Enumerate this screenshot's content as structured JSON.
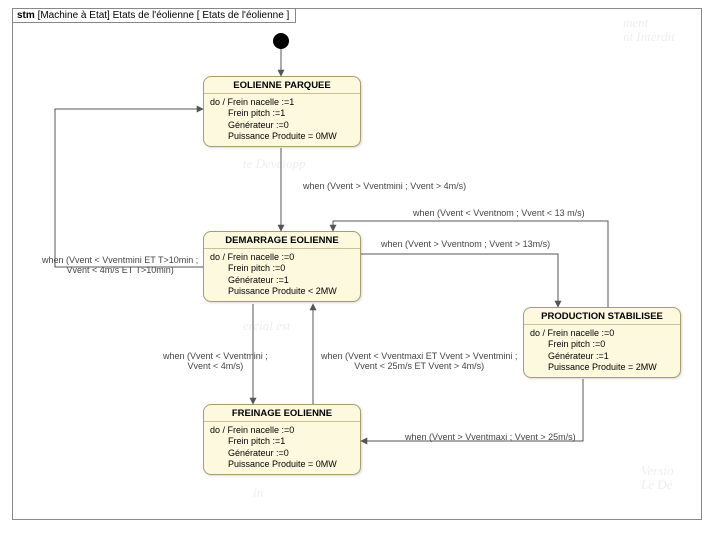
{
  "frame": {
    "kind_bold": "stm",
    "kind_rest": " [Machine à Etat] Etats de l'éolienne [ Etats de l'éolienne ]"
  },
  "states": {
    "parquee": {
      "title": "EOLIENNE PARQUEE",
      "l1": "do / Frein nacelle :=1",
      "l2": "Frein pitch :=1",
      "l3": "Générateur :=0",
      "l4": "Puissance Produite = 0MW"
    },
    "demarrage": {
      "title": "DEMARRAGE EOLIENNE",
      "l1": "do / Frein nacelle :=0",
      "l2": "Frein pitch :=0",
      "l3": "Générateur :=1",
      "l4": "Puissance Produite < 2MW"
    },
    "stab": {
      "title": "PRODUCTION STABILISEE",
      "l1": "do / Frein nacelle :=0",
      "l2": "Frein pitch :=0",
      "l3": "Générateur :=1",
      "l4": "Puissance Produite = 2MW"
    },
    "freinage": {
      "title": "FREINAGE EOLIENNE",
      "l1": "do / Frein nacelle :=0",
      "l2": "Frein pitch :=1",
      "l3": "Générateur :=0",
      "l4": "Puissance Produite = 0MW"
    }
  },
  "guards": {
    "parquee_to_demarrage": "when (Vvent > Vventmini ; Vvent > 4m/s)",
    "demarrage_to_parquee_l1": "when (Vvent < Vventmini ET T>10min ;",
    "demarrage_to_parquee_l2": "Vvent < 4m/s ET T>10min)",
    "demarrage_to_stab": "when (Vvent > Vventnom ; Vvent > 13m/s)",
    "stab_to_demarrage": "when (Vvent < Vventnom ; Vvent < 13 m/s)",
    "demarrage_to_freinage_l1": "when (Vvent < Vventmini ;",
    "demarrage_to_freinage_l2": "Vvent < 4m/s)",
    "freinage_to_demarrage_l1": "when (Vvent < Vventmaxi ET Vvent > Vventmini ;",
    "freinage_to_demarrage_l2": "Vvent < 25m/s ET Vvent > 4m/s)",
    "stab_to_freinage": "when (Vvent > Vventmaxi ; Vvent > 25m/s)"
  },
  "chart_data": {
    "type": "state_machine",
    "title": "Etats de l'éolienne",
    "initial": "EOLIENNE PARQUEE",
    "states": [
      {
        "name": "EOLIENNE PARQUEE",
        "do": [
          "Frein nacelle :=1",
          "Frein pitch :=1",
          "Générateur :=0",
          "Puissance Produite = 0MW"
        ]
      },
      {
        "name": "DEMARRAGE EOLIENNE",
        "do": [
          "Frein nacelle :=0",
          "Frein pitch :=0",
          "Générateur :=1",
          "Puissance Produite < 2MW"
        ]
      },
      {
        "name": "PRODUCTION STABILISEE",
        "do": [
          "Frein nacelle :=0",
          "Frein pitch :=0",
          "Générateur :=1",
          "Puissance Produite = 2MW"
        ]
      },
      {
        "name": "FREINAGE EOLIENNE",
        "do": [
          "Frein nacelle :=0",
          "Frein pitch :=1",
          "Générateur :=0",
          "Puissance Produite = 0MW"
        ]
      }
    ],
    "transitions": [
      {
        "from": "__initial__",
        "to": "EOLIENNE PARQUEE",
        "guard": ""
      },
      {
        "from": "EOLIENNE PARQUEE",
        "to": "DEMARRAGE EOLIENNE",
        "guard": "when (Vvent > Vventmini ; Vvent > 4m/s)"
      },
      {
        "from": "DEMARRAGE EOLIENNE",
        "to": "EOLIENNE PARQUEE",
        "guard": "when (Vvent < Vventmini ET T>10min ; Vvent < 4m/s ET T>10min)"
      },
      {
        "from": "DEMARRAGE EOLIENNE",
        "to": "PRODUCTION STABILISEE",
        "guard": "when (Vvent > Vventnom ; Vvent > 13m/s)"
      },
      {
        "from": "PRODUCTION STABILISEE",
        "to": "DEMARRAGE EOLIENNE",
        "guard": "when (Vvent < Vventnom ; Vvent < 13 m/s)"
      },
      {
        "from": "DEMARRAGE EOLIENNE",
        "to": "FREINAGE EOLIENNE",
        "guard": "when (Vvent < Vventmini ; Vvent < 4m/s)"
      },
      {
        "from": "FREINAGE EOLIENNE",
        "to": "DEMARRAGE EOLIENNE",
        "guard": "when (Vvent < Vventmaxi ET Vvent > Vventmini ; Vvent < 25m/s ET Vvent > 4m/s)"
      },
      {
        "from": "PRODUCTION STABILISEE",
        "to": "FREINAGE EOLIENNE",
        "guard": "when (Vvent > Vventmaxi ; Vvent > 25m/s)"
      }
    ]
  }
}
